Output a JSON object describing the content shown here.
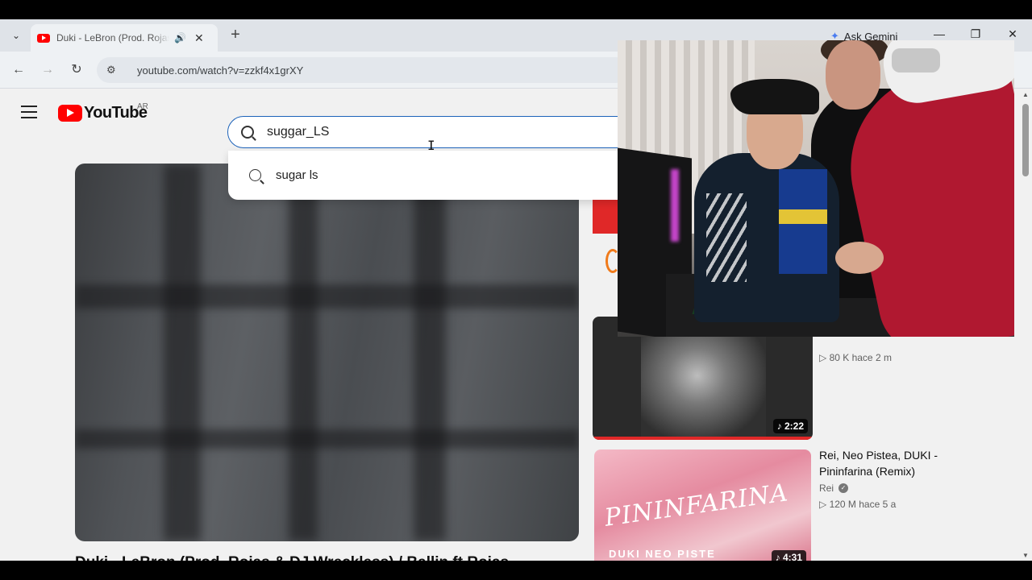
{
  "browser": {
    "tab": {
      "title": "Duki - LeBron (Prod. Rojas & DJ Wreckless) / Ballin ft Rojas",
      "audio_icon": "🔊",
      "close_icon": "✕"
    },
    "tab_list_icon": "⌄",
    "new_tab_icon": "+",
    "ask_gemini_label": "Ask Gemini",
    "window_controls": {
      "minimize": "—",
      "restore": "❐",
      "close": "✕"
    },
    "nav": {
      "back": "←",
      "forward": "→",
      "reload": "↻",
      "site_info": "⚙"
    },
    "url": "youtube.com/watch?v=zzkf4x1grXY"
  },
  "youtube": {
    "logo_text": "YouTube",
    "region": "AR",
    "search": {
      "query": "suggar_LS",
      "suggestions": [
        "sugar ls"
      ]
    },
    "caret": "I",
    "video_title": "Duki - LeBron (Prod. Rojas & DJ Wreckless) / Ballin ft Rojas",
    "recommended": [
      {
        "meta_clip": "▷ 80 K  hace 2 m",
        "duration": "♪ 2:22"
      },
      {
        "title": "Rei, Neo Pistea, DUKI - Pininfarina (Remix)",
        "channel": "Rei",
        "verified_icon": "✓",
        "meta": "▷ 120 M  hace 5 a",
        "duration": "♪ 4:31",
        "thumb_script": "PININFARINA",
        "thumb_labels": "DUKI   NEO PISTE"
      }
    ]
  },
  "scrollbar": {
    "up": "▲",
    "down": "▼"
  },
  "colors": {
    "yt_red": "#ff0000",
    "accent_blue": "#1c62b9"
  }
}
